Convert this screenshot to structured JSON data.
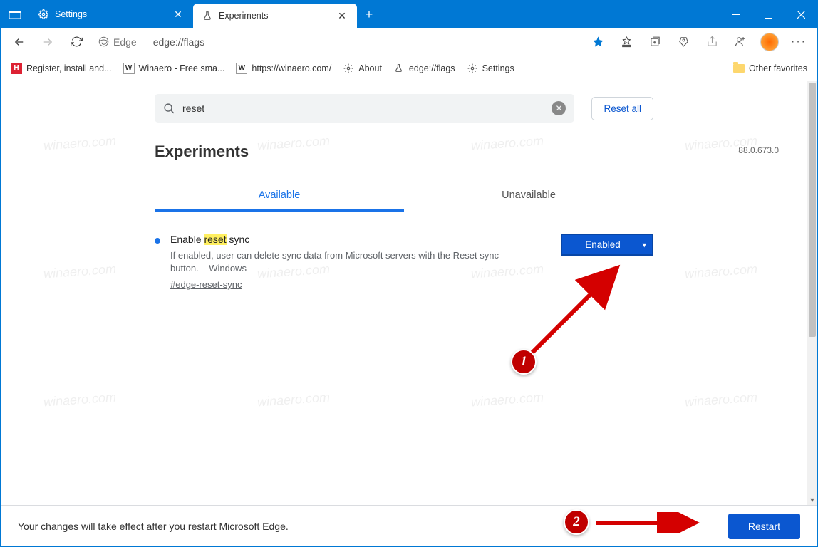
{
  "window": {
    "tabs": [
      {
        "title": "Settings",
        "active": false
      },
      {
        "title": "Experiments",
        "active": true
      }
    ]
  },
  "addressbar": {
    "app_label": "Edge",
    "url": "edge://flags"
  },
  "bookmarks": [
    {
      "label": "Register, install and..."
    },
    {
      "label": "Winaero - Free sma..."
    },
    {
      "label": "https://winaero.com/"
    },
    {
      "label": "About"
    },
    {
      "label": "edge://flags"
    },
    {
      "label": "Settings"
    }
  ],
  "bookmarks_other": "Other favorites",
  "flags_page": {
    "search_value": "reset",
    "reset_all": "Reset all",
    "title": "Experiments",
    "version": "88.0.673.0",
    "tab_available": "Available",
    "tab_unavailable": "Unavailable",
    "flag": {
      "title_pre": "Enable ",
      "title_hl": "reset",
      "title_post": " sync",
      "desc": "If enabled, user can delete sync data from Microsoft servers with the Reset sync button. – Windows",
      "anchor": "#edge-reset-sync",
      "select_value": "Enabled"
    }
  },
  "bottom_bar": {
    "message": "Your changes will take effect after you restart Microsoft Edge.",
    "restart": "Restart"
  },
  "annotations": {
    "badge1": "1",
    "badge2": "2"
  },
  "watermark": "winaero.com"
}
